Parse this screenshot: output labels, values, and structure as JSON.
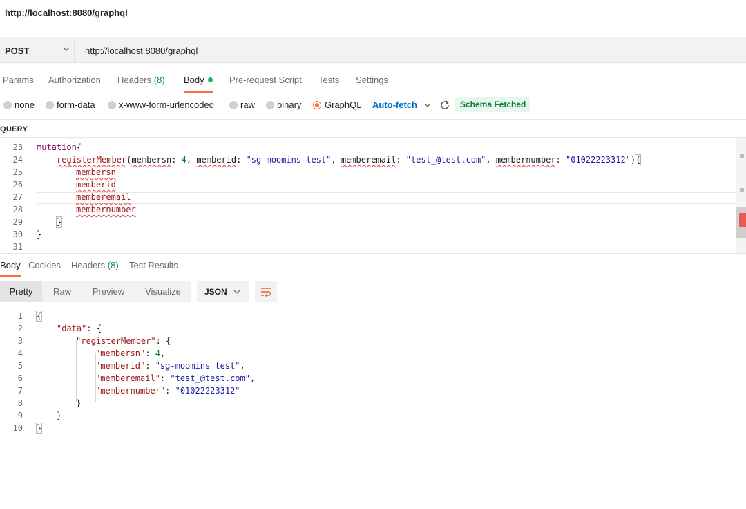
{
  "window": {
    "title": "http://localhost:8080/graphql"
  },
  "request": {
    "method": "POST",
    "url": "http://localhost:8080/graphql",
    "icons": {
      "method_chevron": "chevron-down-icon"
    }
  },
  "request_tabs": [
    {
      "label": "Params"
    },
    {
      "label": "Authorization"
    },
    {
      "label": "Headers",
      "count": "(8)"
    },
    {
      "label": "Body",
      "active": true,
      "dot_color": "#0cbb52"
    },
    {
      "label": "Pre-request Script"
    },
    {
      "label": "Tests"
    },
    {
      "label": "Settings"
    }
  ],
  "body_types": {
    "options": [
      "none",
      "form-data",
      "x-www-form-urlencoded",
      "raw",
      "binary",
      "GraphQL"
    ],
    "selected": "GraphQL",
    "auto_fetch": "Auto-fetch",
    "schema_status": "Schema Fetched"
  },
  "query_section": {
    "label": "QUERY"
  },
  "query_editor": {
    "lines": [
      {
        "n": "23",
        "text": "mutation{"
      },
      {
        "n": "24",
        "text": "registerMember(membersn: 4, memberid: \"sg-moomins test\", memberemail: \"test_@test.com\", membernumber: \"01022223312\"){"
      },
      {
        "n": "25",
        "text": "membersn"
      },
      {
        "n": "26",
        "text": "memberid"
      },
      {
        "n": "27",
        "text": "memberemail"
      },
      {
        "n": "28",
        "text": "membernumber"
      },
      {
        "n": "29",
        "text": "}"
      },
      {
        "n": "30",
        "text": "}"
      },
      {
        "n": "31",
        "text": ""
      }
    ],
    "tokens": {
      "mutation_kw": "mutation",
      "open_brace": "{",
      "fn_name": "registerMember",
      "arg1": "membersn",
      "arg1_val": "4",
      "arg2": "memberid",
      "arg2_val": "\"sg-moomins test\"",
      "arg3": "memberemail",
      "arg3_val": "\"test_@test.com\"",
      "arg4": "membernumber",
      "arg4_val": "\"01022223312\"",
      "field1": "membersn",
      "field2": "memberid",
      "field3": "memberemail",
      "field4": "membernumber",
      "close_brace": "}"
    }
  },
  "response_tabs": [
    {
      "label": "Body",
      "active": true
    },
    {
      "label": "Cookies"
    },
    {
      "label": "Headers",
      "count": "(8)"
    },
    {
      "label": "Test Results"
    }
  ],
  "view_modes": [
    "Pretty",
    "Raw",
    "Preview",
    "Visualize"
  ],
  "view_selected": "Pretty",
  "format": "JSON",
  "response_body": {
    "line_numbers": [
      "1",
      "2",
      "3",
      "4",
      "5",
      "6",
      "7",
      "8",
      "9",
      "10"
    ],
    "open": "{",
    "close": "}",
    "data_key": "\"data\"",
    "register_key": "\"registerMember\"",
    "membersn_key": "\"membersn\"",
    "membersn_val": "4",
    "memberid_key": "\"memberid\"",
    "memberid_val": "\"sg-moomins test\"",
    "memberemail_key": "\"memberemail\"",
    "memberemail_val": "\"test_@test.com\"",
    "membernumber_key": "\"membernumber\"",
    "membernumber_val": "\"01022223312\""
  },
  "colors": {
    "accent": "#ff6c37",
    "link": "#0265d2",
    "success": "#0f7a3a"
  }
}
